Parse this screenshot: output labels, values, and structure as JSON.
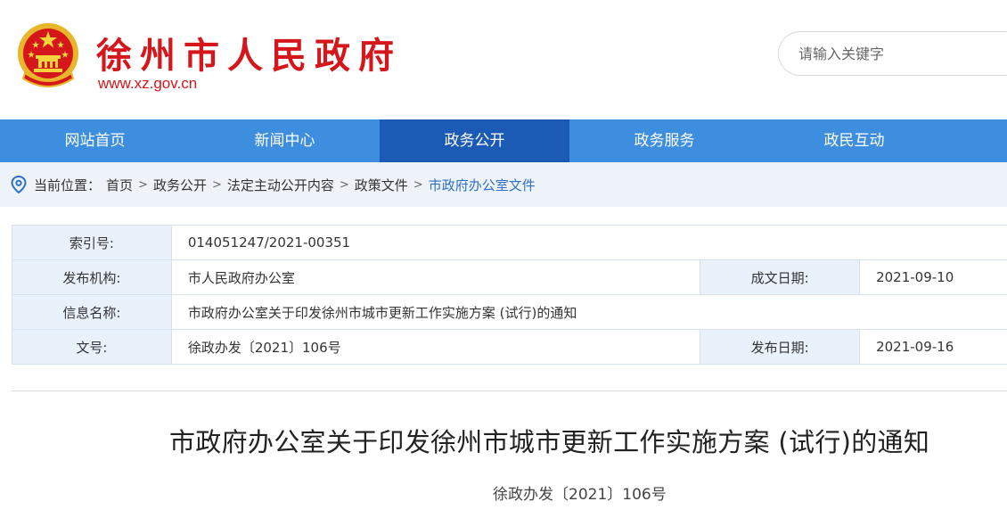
{
  "header": {
    "site_title": "徐州市人民政府",
    "site_url": "www.xz.gov.cn",
    "emblem_icon": "national-emblem-icon",
    "brand_color": "#d5161a"
  },
  "search": {
    "placeholder": "请输入关键字"
  },
  "nav": {
    "items": [
      {
        "label": "网站首页"
      },
      {
        "label": "新闻中心"
      },
      {
        "label": "政务公开"
      },
      {
        "label": "政务服务"
      },
      {
        "label": "政民互动"
      }
    ],
    "active": "政务公开",
    "bar_color": "#3e8ee0",
    "active_color": "#1c5bb5"
  },
  "breadcrumb": {
    "label": "当前位置：",
    "items": [
      "首页",
      "政务公开",
      "法定主动公开内容",
      "政策文件",
      "市政府办公室文件"
    ],
    "separator": ">",
    "icon": "location-pin-icon"
  },
  "info": {
    "index_label": "索引号:",
    "index_value": "014051247/2021-00351",
    "publisher_label": "发布机构:",
    "publisher_value": "市人民政府办公室",
    "created_label": "成文日期:",
    "created_value": "2021-09-10",
    "name_label": "信息名称:",
    "name_value": "市政府办公室关于印发徐州市城市更新工作实施方案 (试行)的通知",
    "docno_label": "文号:",
    "docno_value": "徐政办发〔2021〕106号",
    "published_label": "发布日期:",
    "published_value": "2021-09-16"
  },
  "document": {
    "title": "市政府办公室关于印发徐州市城市更新工作实施方案 (试行)的通知",
    "number": "徐政办发〔2021〕106号"
  }
}
